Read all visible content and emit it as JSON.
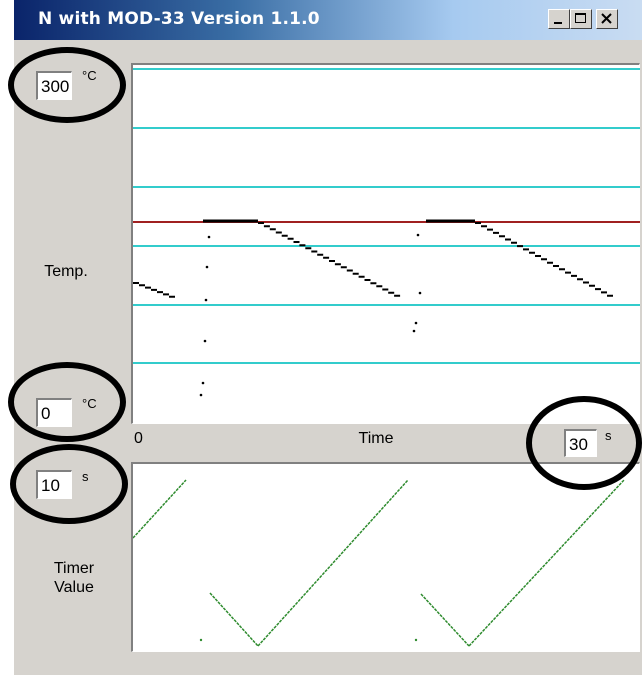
{
  "window": {
    "title": "N with MOD-33 Version 1.1.0",
    "buttons": [
      "minimize",
      "maximize",
      "close"
    ]
  },
  "temp_panel": {
    "max_value": "300",
    "max_unit": "°C",
    "min_value": "0",
    "min_unit": "°C",
    "axis_label": "Temp.",
    "x_start": "0",
    "x_label": "Time",
    "span_value": "30",
    "span_unit": "s"
  },
  "timer_panel": {
    "max_value": "10",
    "max_unit": "s",
    "label_line1": "Timer",
    "label_line2": "Value"
  },
  "colors": {
    "gridline": "#33cccc",
    "setpoint": "#a02020",
    "temperature_trace": "#000000",
    "timer_trace": "#2e8b2e",
    "title_gradient_start": "#0a246a",
    "window_face": "#d6d3ce"
  },
  "icons": [
    "minimize-icon",
    "maximize-icon",
    "close-icon"
  ]
}
